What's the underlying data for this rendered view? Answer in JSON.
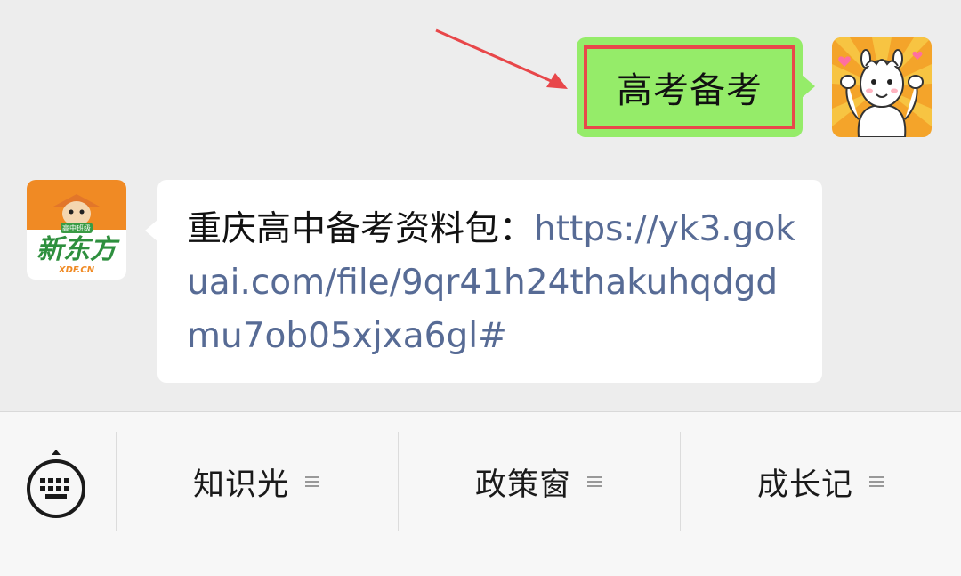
{
  "chat": {
    "sent_message": "高考备考",
    "received_message": {
      "prefix": "重庆高中备考资料包：",
      "link": "https://yk3.gokuai.com/file/9qr41h24thakuhqdgdmu7ob05xjxa6gl#"
    },
    "brand_avatar": {
      "badge": "高中班级",
      "logo_text": "新东方",
      "logo_sub": "XDF.CN"
    }
  },
  "menu_bar": {
    "items": [
      {
        "label": "知识光",
        "icon": "menu-lines-icon"
      },
      {
        "label": "政策窗",
        "icon": "menu-lines-icon"
      },
      {
        "label": "成长记",
        "icon": "menu-lines-icon"
      }
    ],
    "keyboard_icon": "keyboard-icon"
  },
  "colors": {
    "sent_bubble": "#95ec69",
    "received_bubble": "#ffffff",
    "link": "#576b95",
    "highlight": "#e8474a",
    "background": "#ededed"
  }
}
